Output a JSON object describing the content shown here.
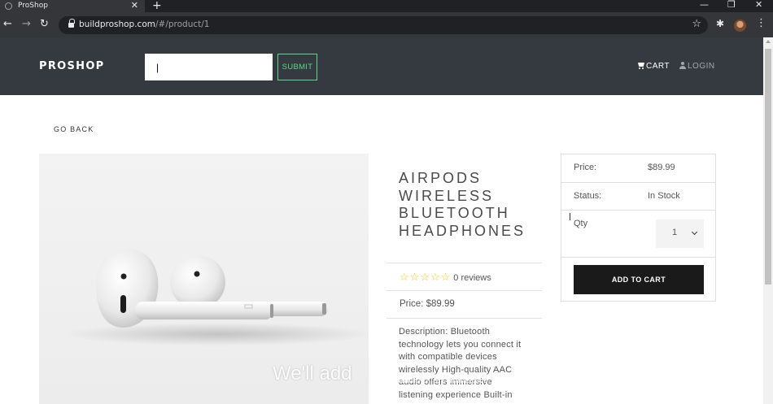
{
  "browser": {
    "tab_title": "ProShop",
    "new_tab_symbol": "+",
    "url_host": "buildproshop.com",
    "url_path": "/#/product/1"
  },
  "navbar": {
    "brand": "PROSHOP",
    "search_value": "|",
    "submit_label": "SUBMIT",
    "cart_label": "CART",
    "login_label": "LOGIN"
  },
  "page": {
    "go_back_label": "GO BACK"
  },
  "product": {
    "title": "AIRPODS WIRELESS BLUETOOTH HEADPHONES",
    "rating": 0,
    "stars": "☆☆☆☆☆",
    "reviews_text": "0 reviews",
    "price_text": "Price: $89.99",
    "description": "Description: Bluetooth technology lets you connect it with compatible devices wirelessly High-quality AAC audio offers immersive listening experience Built-in"
  },
  "cart_card": {
    "price_label": "Price:",
    "price_value": "$89.99",
    "status_label": "Status:",
    "status_value": "In Stock",
    "qty_label": "Qty",
    "qty_value": "1",
    "add_button_label": "ADD TO CART"
  },
  "overlay": {
    "caption": "We'll add",
    "caption2": "audio offers immersive"
  },
  "colors": {
    "navbar_bg": "#343a40",
    "submit_accent": "#5bd68b",
    "star_color": "#f1c40f",
    "button_bg": "#1a1a1a"
  }
}
